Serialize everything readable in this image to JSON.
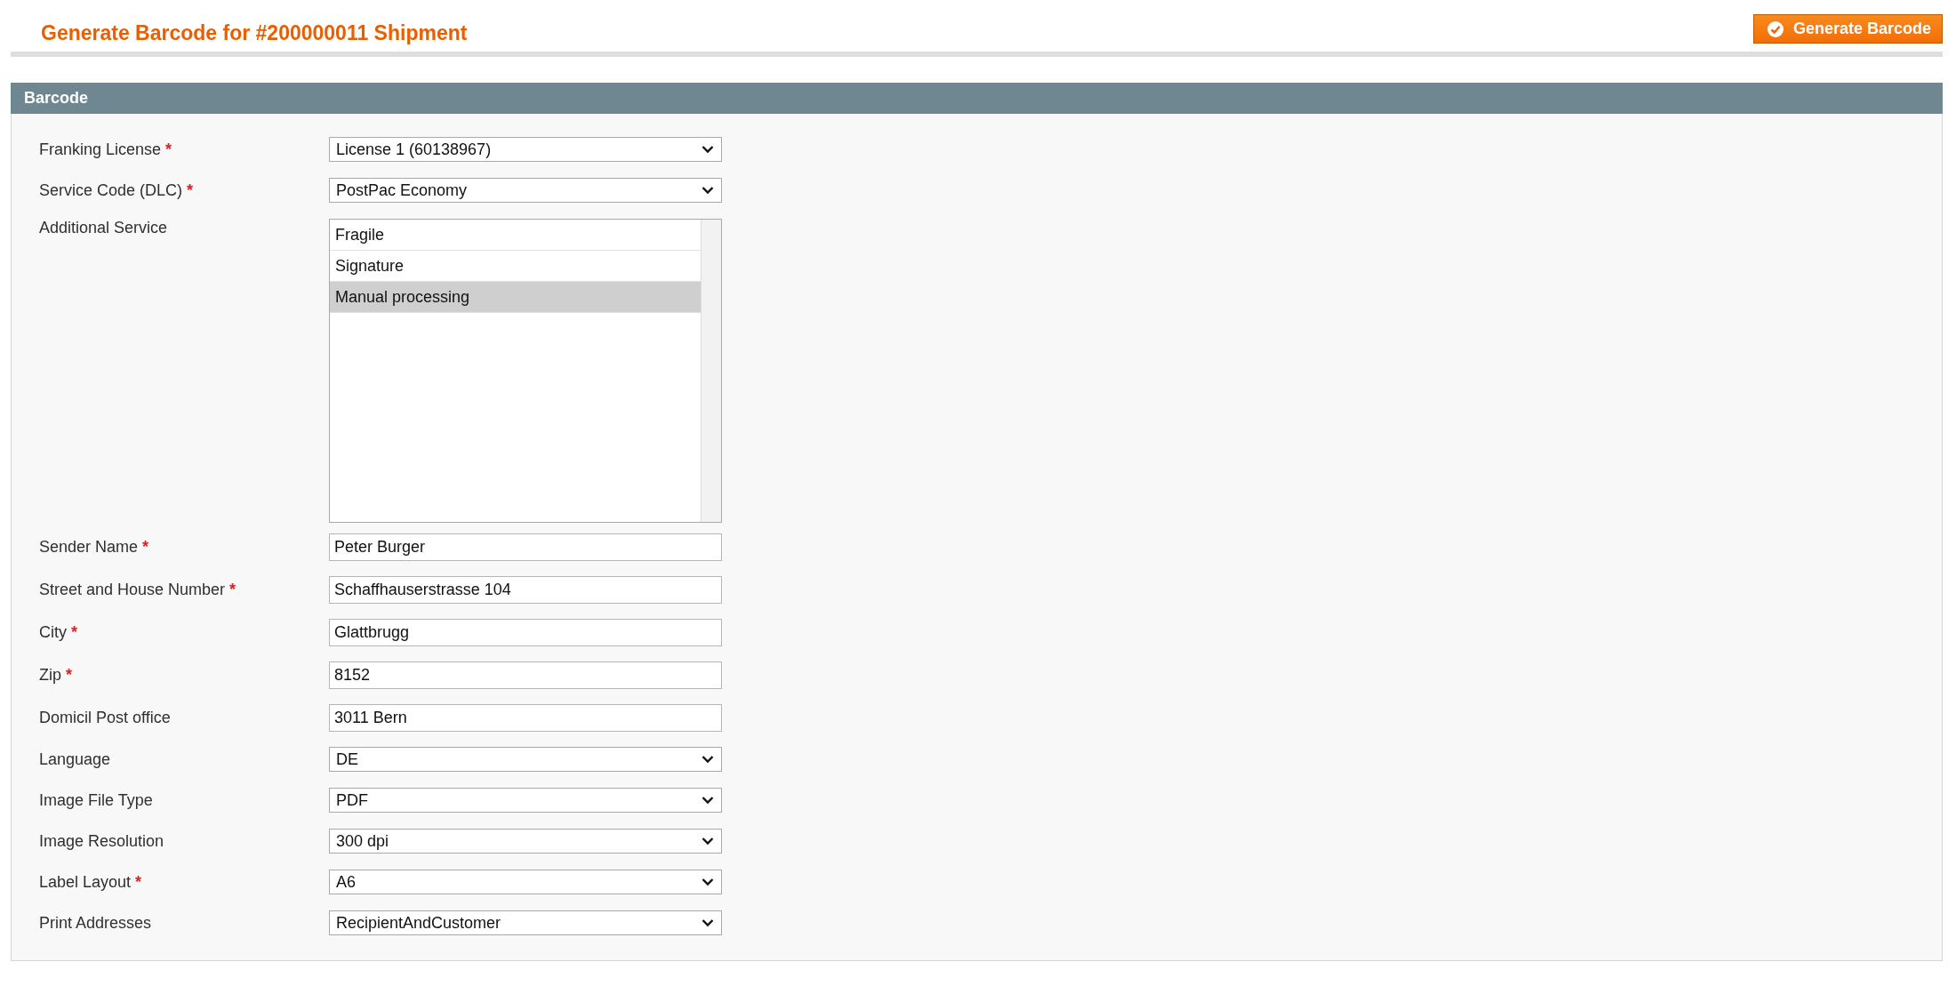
{
  "header": {
    "title": "Generate Barcode for #200000011 Shipment",
    "action_button": "Generate Barcode"
  },
  "section": {
    "title": "Barcode",
    "fields": [
      {
        "kind": "select",
        "label": "Franking License",
        "required_mark": "*",
        "value": "License 1 (60138967)"
      },
      {
        "kind": "select",
        "label": "Service Code (DLC)",
        "required_mark": "*",
        "value": "PostPac Economy"
      },
      {
        "kind": "listbox",
        "label": "Additional Service",
        "options": [
          {
            "label": "Fragile",
            "selected": false
          },
          {
            "label": "Signature",
            "selected": false
          },
          {
            "label": "Manual processing",
            "selected": true
          }
        ]
      },
      {
        "kind": "text",
        "label": "Sender Name",
        "required_mark": "*",
        "value": "Peter Burger"
      },
      {
        "kind": "text",
        "label": "Street and House Number",
        "required_mark": "*",
        "value": "Schaffhauserstrasse 104"
      },
      {
        "kind": "text",
        "label": "City",
        "required_mark": "*",
        "value": "Glattbrugg"
      },
      {
        "kind": "text",
        "label": "Zip",
        "required_mark": "*",
        "value": "8152"
      },
      {
        "kind": "text",
        "label": "Domicil Post office",
        "value": "3011 Bern"
      },
      {
        "kind": "select",
        "label": "Language",
        "value": "DE"
      },
      {
        "kind": "select",
        "label": "Image File Type",
        "value": "PDF"
      },
      {
        "kind": "select",
        "label": "Image Resolution",
        "value": "300 dpi"
      },
      {
        "kind": "select",
        "label": "Label Layout",
        "required_mark": "*",
        "value": "A6"
      },
      {
        "kind": "select",
        "label": "Print Addresses",
        "value": "RecipientAndCustomer"
      }
    ]
  }
}
